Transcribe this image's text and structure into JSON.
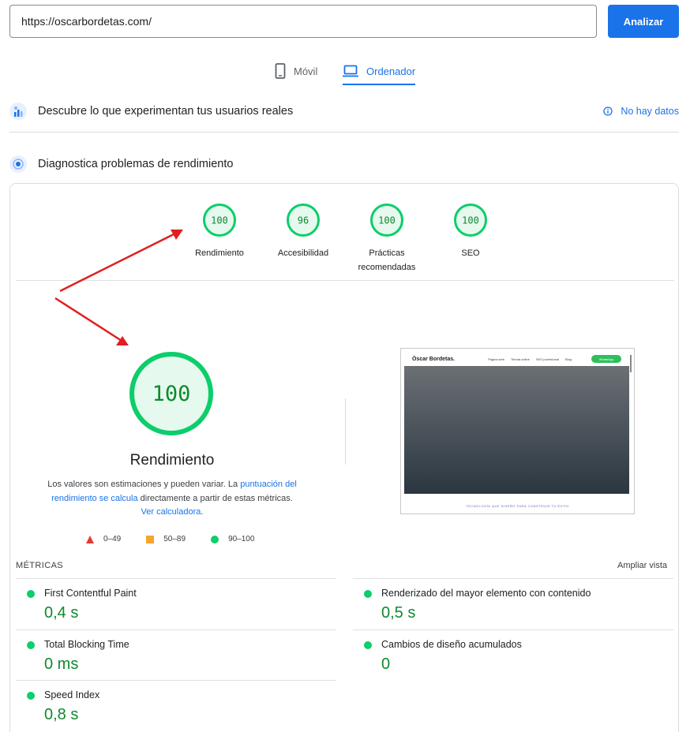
{
  "url_bar": {
    "value": "https://oscarbordetas.com/"
  },
  "analyze_button": "Analizar",
  "tabs": [
    {
      "label": "Móvil",
      "icon": "phone-icon",
      "active": false
    },
    {
      "label": "Ordenador",
      "icon": "laptop-icon",
      "active": true
    }
  ],
  "field_section": {
    "title": "Descubre lo que experimentan tus usuarios reales",
    "no_data": "No hay datos"
  },
  "lab_section": {
    "title": "Diagnostica problemas de rendimiento"
  },
  "scores": [
    {
      "value": "100",
      "label": "Rendimiento"
    },
    {
      "value": "96",
      "label": "Accesibilidad"
    },
    {
      "value": "100",
      "label_line1": "Prácticas",
      "label_line2": "recomendadas"
    },
    {
      "value": "100",
      "label": "SEO"
    }
  ],
  "main_score": {
    "value": "100",
    "title": "Rendimiento",
    "desc_1": "Los valores son estimaciones y pueden variar. La ",
    "link_1": "puntuación del rendimiento se calcula",
    "desc_2": " directamente a partir de estas métricas. ",
    "link_2": "Ver calculadora",
    "desc_3": "."
  },
  "legend": [
    {
      "range": "0–49",
      "shape": "triangle",
      "color": "#e53935"
    },
    {
      "range": "50–89",
      "shape": "square",
      "color": "#f4a52f"
    },
    {
      "range": "90–100",
      "shape": "circle",
      "color": "#0cce6b"
    }
  ],
  "preview": {
    "brand": "Òscar Bordetas.",
    "links": [
      "Página web",
      "Tienda online",
      "SEO profesional",
      "Blog"
    ],
    "button": "WhatsApp",
    "footer": "TECNOLOGÍA QUE DISEÑO PARA CONSTRUIR TU ÉXITO"
  },
  "metrics": {
    "heading": "MÉTRICAS",
    "expand": "Ampliar vista",
    "items": [
      {
        "name": "First Contentful Paint",
        "value": "0,4 s"
      },
      {
        "name": "Renderizado del mayor elemento con contenido",
        "value": "0,5 s"
      },
      {
        "name": "Total Blocking Time",
        "value": "0 ms"
      },
      {
        "name": "Cambios de diseño acumulados",
        "value": "0"
      },
      {
        "name": "Speed Index",
        "value": "0,8 s"
      }
    ]
  },
  "colors": {
    "accent": "#1a73e8",
    "pass": "#0cce6b",
    "pass_text": "#0d8a2e",
    "arrow": "#e02020"
  }
}
